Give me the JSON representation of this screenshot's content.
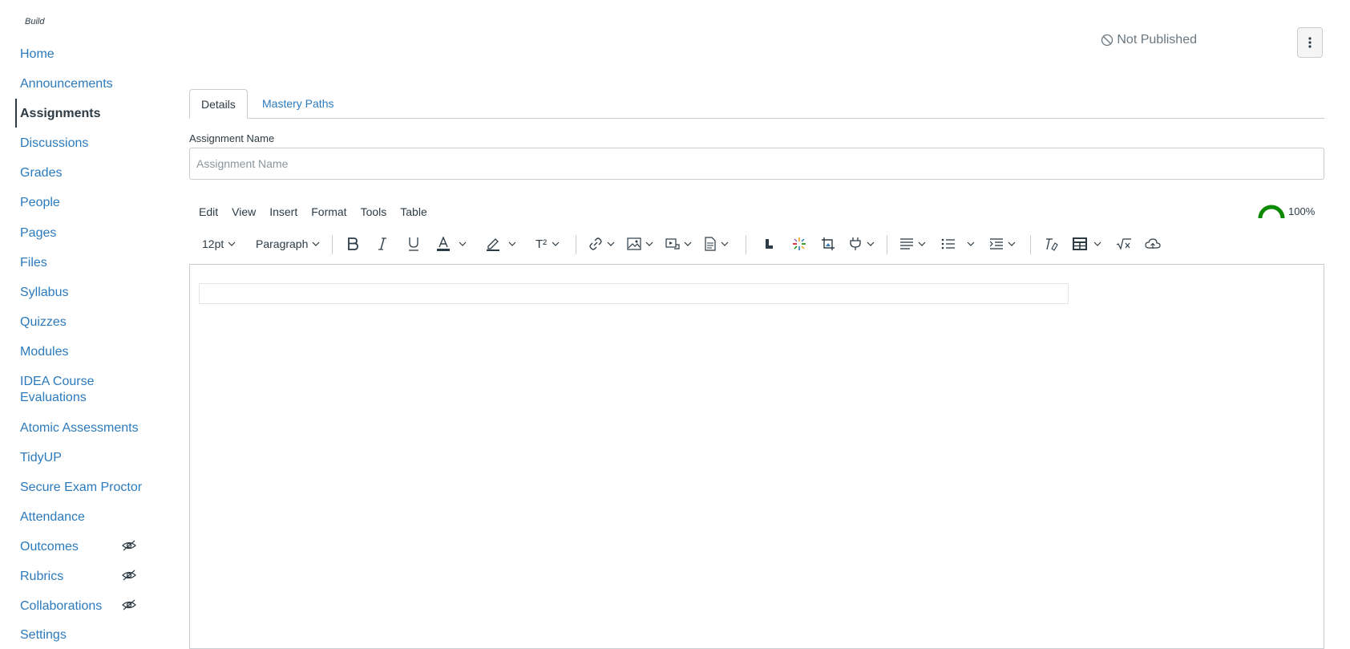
{
  "sidebar": {
    "build_label": "Build",
    "items": [
      {
        "label": "Home"
      },
      {
        "label": "Announcements"
      },
      {
        "label": "Assignments"
      },
      {
        "label": "Discussions"
      },
      {
        "label": "Grades"
      },
      {
        "label": "People"
      },
      {
        "label": "Pages"
      },
      {
        "label": "Files"
      },
      {
        "label": "Syllabus"
      },
      {
        "label": "Quizzes"
      },
      {
        "label": "Modules"
      },
      {
        "label": "IDEA Course Evaluations"
      },
      {
        "label": "Atomic Assessments"
      },
      {
        "label": "TidyUP"
      },
      {
        "label": "Secure Exam Proctor"
      },
      {
        "label": "Attendance"
      },
      {
        "label": "Outcomes",
        "hidden_from_students": true
      },
      {
        "label": "Rubrics",
        "hidden_from_students": true
      },
      {
        "label": "Collaborations",
        "hidden_from_students": true
      },
      {
        "label": "Settings"
      }
    ],
    "active_item": "Assignments"
  },
  "header": {
    "publish_status": "Not Published",
    "more_icon": "kebab-menu-icon"
  },
  "tabs": [
    {
      "label": "Details",
      "selected": true
    },
    {
      "label": "Mastery Paths",
      "selected": false
    }
  ],
  "form": {
    "name_label": "Assignment Name",
    "name_placeholder": "Assignment Name",
    "name_value": ""
  },
  "editor": {
    "menubar": [
      "Edit",
      "View",
      "Insert",
      "Format",
      "Tools",
      "Table"
    ],
    "accessibility_score": "100%",
    "font_size": "12pt",
    "block_format": "Paragraph",
    "superscript_label": "T²"
  },
  "colors": {
    "link": "#2b7abc",
    "text": "#2d3b45",
    "border": "#c7cdd1",
    "gauge": "#0b8a00"
  }
}
